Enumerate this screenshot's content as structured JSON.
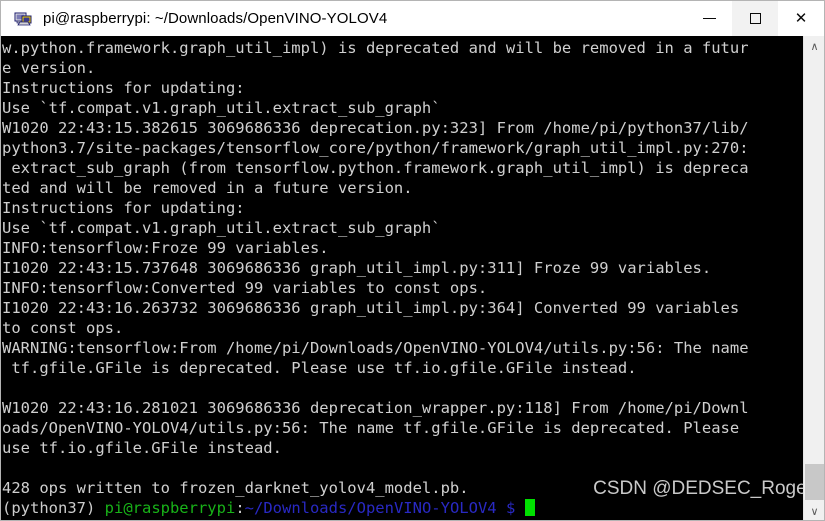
{
  "window": {
    "title": "pi@raspberrypi: ~/Downloads/OpenVINO-YOLOV4",
    "icon": "putty-terminal-icon",
    "controls": {
      "minimize_label": "—",
      "maximize_label": "☐",
      "close_label": "✕"
    }
  },
  "terminal": {
    "background_color": "#000000",
    "foreground_color": "#cccccc",
    "cursor_color": "#00e000",
    "lines": [
      "w.python.framework.graph_util_impl) is deprecated and will be removed in a futur",
      "e version.",
      "Instructions for updating:",
      "Use `tf.compat.v1.graph_util.extract_sub_graph`",
      "W1020 22:43:15.382615 3069686336 deprecation.py:323] From /home/pi/python37/lib/",
      "python3.7/site-packages/tensorflow_core/python/framework/graph_util_impl.py:270:",
      " extract_sub_graph (from tensorflow.python.framework.graph_util_impl) is depreca",
      "ted and will be removed in a future version.",
      "Instructions for updating:",
      "Use `tf.compat.v1.graph_util.extract_sub_graph`",
      "INFO:tensorflow:Froze 99 variables.",
      "I1020 22:43:15.737648 3069686336 graph_util_impl.py:311] Froze 99 variables.",
      "INFO:tensorflow:Converted 99 variables to const ops.",
      "I1020 22:43:16.263732 3069686336 graph_util_impl.py:364] Converted 99 variables",
      "to const ops.",
      "WARNING:tensorflow:From /home/pi/Downloads/OpenVINO-YOLOV4/utils.py:56: The name",
      " tf.gfile.GFile is deprecated. Please use tf.io.gfile.GFile instead.",
      "",
      "W1020 22:43:16.281021 3069686336 deprecation_wrapper.py:118] From /home/pi/Downl",
      "oads/OpenVINO-YOLOV4/utils.py:56: The name tf.gfile.GFile is deprecated. Please",
      "use tf.io.gfile.GFile instead.",
      "",
      "428 ops written to frozen_darknet_yolov4_model.pb."
    ],
    "prompt": {
      "venv": "(python37) ",
      "user_host": "pi@raspberrypi",
      "colon": ":",
      "path": "~/Downloads/OpenVINO-YOLOV4",
      "sigil": " $ ",
      "venv_color": "#cccccc",
      "user_host_color": "#18b218",
      "path_color": "#2929c4",
      "sigil_color": "#2929c4"
    }
  },
  "watermark": {
    "text": "CSDN @DEDSEC_Roger"
  },
  "scrollbar": {
    "up_arrow": "∧",
    "down_arrow": "∨"
  }
}
